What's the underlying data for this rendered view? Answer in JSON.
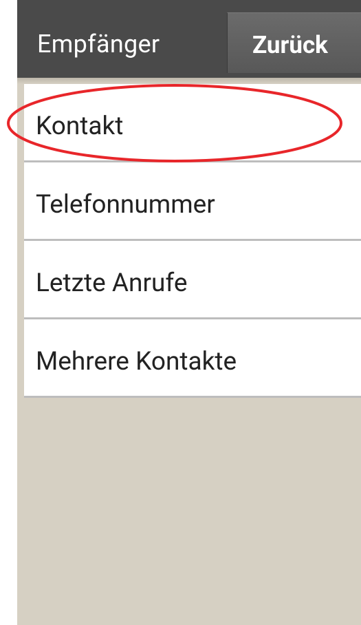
{
  "header": {
    "title": "Empfänger",
    "back_label": "Zurück"
  },
  "menu": {
    "items": [
      {
        "label": "Kontakt"
      },
      {
        "label": "Telefonnummer"
      },
      {
        "label": "Letzte Anrufe"
      },
      {
        "label": "Mehrere Kontakte"
      }
    ]
  },
  "colors": {
    "header_bg": "#4a4a4a",
    "page_bg": "#d6d0c3",
    "highlight": "#e8262a"
  }
}
